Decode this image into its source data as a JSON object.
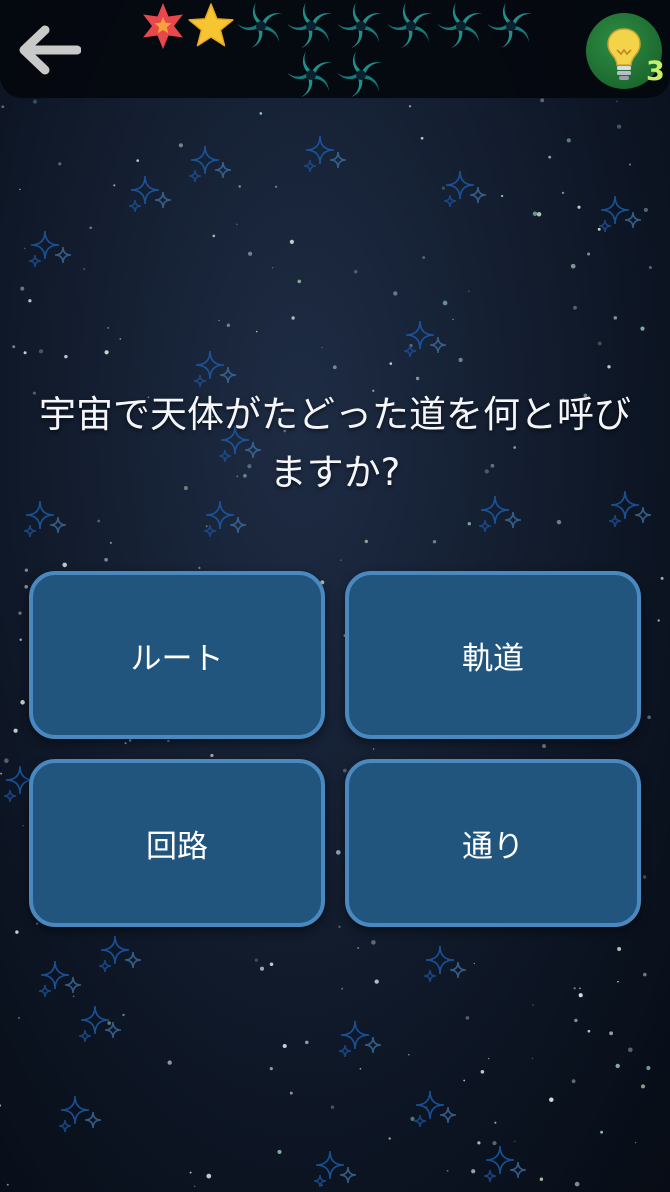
{
  "header": {
    "back_icon": "arrow-left-icon",
    "progress": [
      {
        "state": "wrong",
        "icon": "red-star-icon",
        "color": "#e8484b"
      },
      {
        "state": "correct",
        "icon": "gold-star-icon",
        "color": "#f6c531"
      },
      {
        "state": "pending",
        "icon": "spiral-galaxy-icon",
        "color": "#1f8f8a"
      },
      {
        "state": "pending",
        "icon": "spiral-galaxy-icon",
        "color": "#1f8f8a"
      },
      {
        "state": "pending",
        "icon": "spiral-galaxy-icon",
        "color": "#1f8f8a"
      },
      {
        "state": "pending",
        "icon": "spiral-galaxy-icon",
        "color": "#1f8f8a"
      },
      {
        "state": "pending",
        "icon": "spiral-galaxy-icon",
        "color": "#1f8f8a"
      },
      {
        "state": "pending",
        "icon": "spiral-galaxy-icon",
        "color": "#1f8f8a"
      },
      {
        "state": "pending",
        "icon": "spiral-galaxy-icon",
        "color": "#1f8f8a"
      },
      {
        "state": "pending",
        "icon": "spiral-galaxy-icon",
        "color": "#1f8f8a"
      }
    ],
    "hint": {
      "icon": "lightbulb-icon",
      "count": "3",
      "color": "#2a8040"
    }
  },
  "question": {
    "line1": "宇宙で天体がたどった道を何と呼び",
    "line2": "ますか?"
  },
  "answers": [
    {
      "label": "ルート"
    },
    {
      "label": "軌道"
    },
    {
      "label": "回路"
    },
    {
      "label": "通り"
    }
  ],
  "colors": {
    "answer_fill": "#21557d",
    "answer_border": "#4a89c0",
    "background": "#152033"
  }
}
